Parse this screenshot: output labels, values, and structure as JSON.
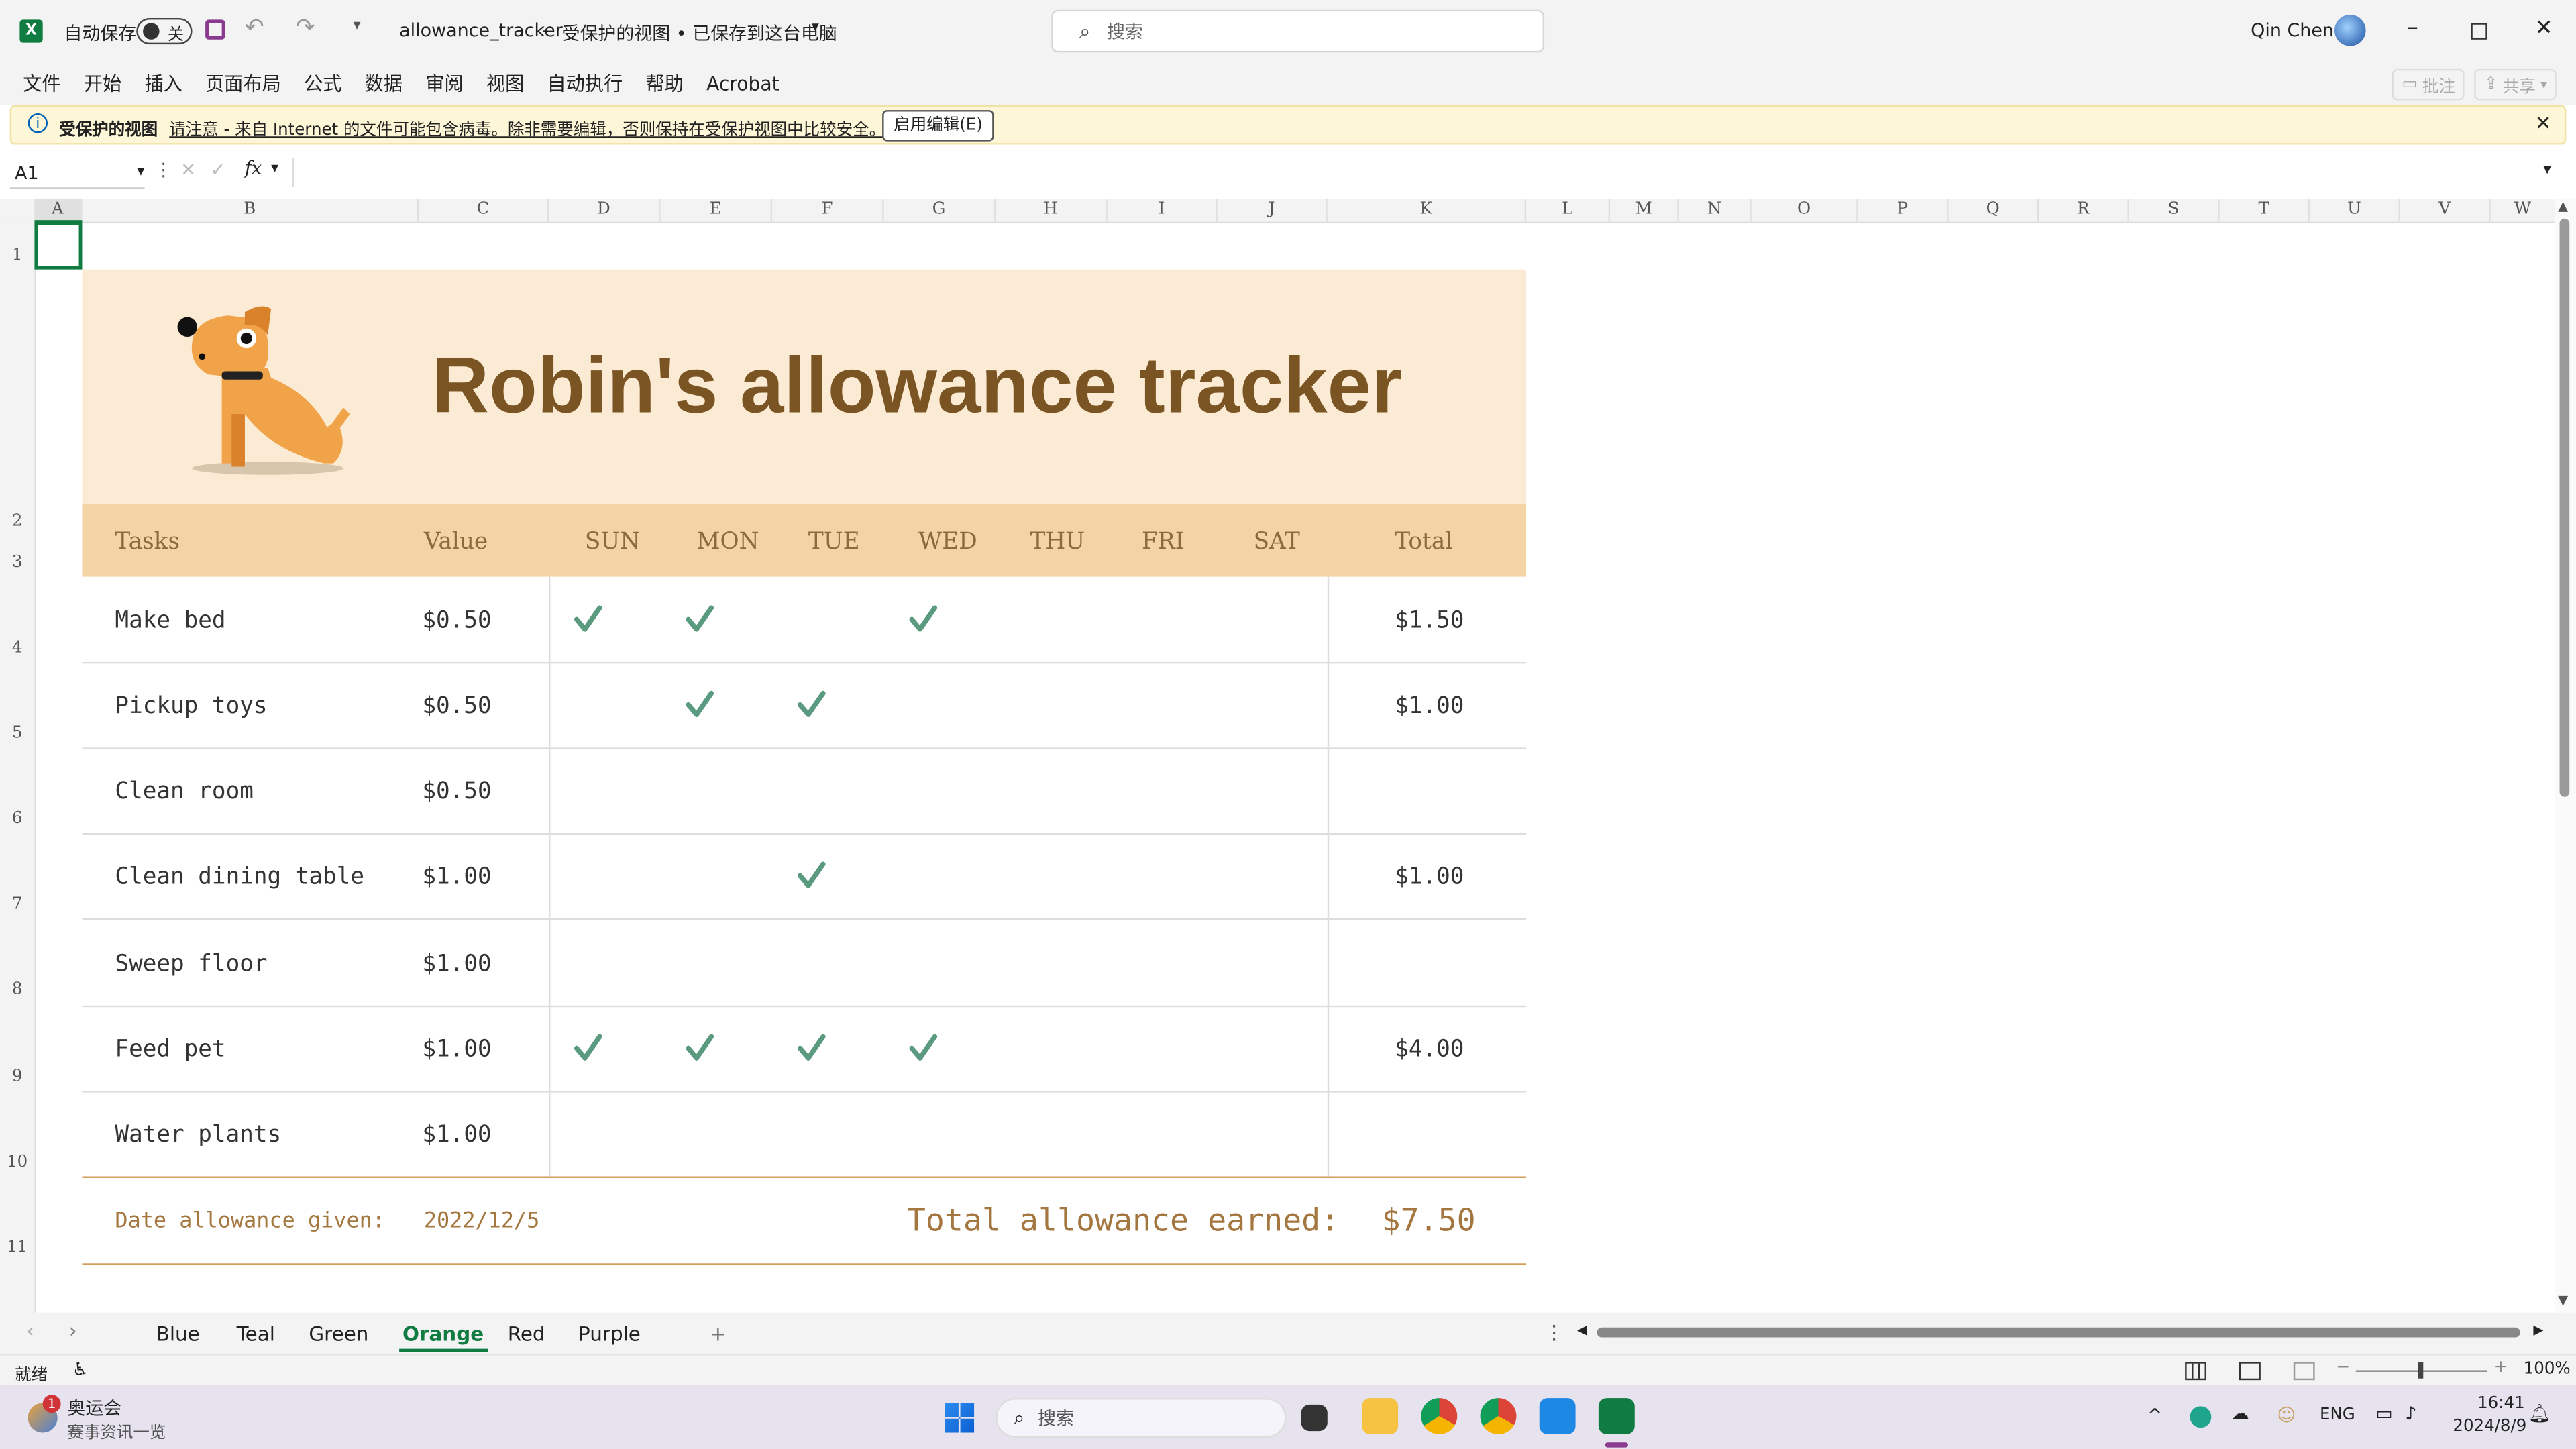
{
  "titlebar": {
    "autosave_label": "自动保存",
    "autosave_state": "关",
    "filename": "allowance_tracker",
    "subtitle": "受保护的视图 • 已保存到这台电脑",
    "search_placeholder": "搜索",
    "user_name": "Qin Chen"
  },
  "menu": {
    "items": [
      "文件",
      "开始",
      "插入",
      "页面布局",
      "公式",
      "数据",
      "审阅",
      "视图",
      "自动执行",
      "帮助",
      "Acrobat"
    ],
    "comment_label": "批注",
    "share_label": "共享"
  },
  "protected": {
    "title": "受保护的视图",
    "message": "请注意 - 来自 Internet 的文件可能包含病毒。除非需要编辑，否则保持在受保护视图中比较安全。",
    "enable_button": "启用编辑(E)"
  },
  "formula_bar": {
    "cell_ref": "A1",
    "fx": "fx",
    "content": ""
  },
  "columns": [
    "A",
    "B",
    "C",
    "D",
    "E",
    "F",
    "G",
    "H",
    "I",
    "J",
    "K",
    "L",
    "M",
    "N",
    "O",
    "P",
    "Q",
    "R",
    "S",
    "T",
    "U",
    "V",
    "W"
  ],
  "rows": [
    "1",
    "2",
    "3",
    "4",
    "5",
    "6",
    "7",
    "8",
    "9",
    "10",
    "11"
  ],
  "tracker": {
    "title": "Robin's allowance tracker",
    "headers": {
      "tasks": "Tasks",
      "value": "Value",
      "days": [
        "SUN",
        "MON",
        "TUE",
        "WED",
        "THU",
        "FRI",
        "SAT"
      ],
      "total": "Total"
    },
    "tasks": [
      {
        "name": "Make bed",
        "value": "$0.50",
        "checks": [
          true,
          true,
          false,
          true,
          false,
          false,
          false
        ],
        "total": "$1.50"
      },
      {
        "name": "Pickup toys",
        "value": "$0.50",
        "checks": [
          false,
          true,
          true,
          false,
          false,
          false,
          false
        ],
        "total": "$1.00"
      },
      {
        "name": "Clean room",
        "value": "$0.50",
        "checks": [
          false,
          false,
          false,
          false,
          false,
          false,
          false
        ],
        "total": ""
      },
      {
        "name": "Clean dining table",
        "value": "$1.00",
        "checks": [
          false,
          false,
          true,
          false,
          false,
          false,
          false
        ],
        "total": "$1.00"
      },
      {
        "name": "Sweep floor",
        "value": "$1.00",
        "checks": [
          false,
          false,
          false,
          false,
          false,
          false,
          false
        ],
        "total": ""
      },
      {
        "name": "Feed pet",
        "value": "$1.00",
        "checks": [
          true,
          true,
          true,
          true,
          false,
          false,
          false
        ],
        "total": "$4.00"
      },
      {
        "name": "Water plants",
        "value": "$1.00",
        "checks": [
          false,
          false,
          false,
          false,
          false,
          false,
          false
        ],
        "total": ""
      }
    ],
    "date_label": "Date allowance given:",
    "date_value": "2022/12/5",
    "total_label": "Total allowance earned:",
    "total_value": "$7.50"
  },
  "sheets": {
    "tabs": [
      "Blue",
      "Teal",
      "Green",
      "Orange",
      "Red",
      "Purple"
    ],
    "active": "Orange",
    "add_label": "+"
  },
  "status": {
    "ready": "就绪",
    "zoom": "100%"
  },
  "taskbar": {
    "widget_title": "奥运会",
    "widget_sub": "赛事资讯一览",
    "widget_badge": "1",
    "search_placeholder": "搜索",
    "lang": "ENG",
    "time": "16:41",
    "date": "2024/8/9"
  },
  "colors": {
    "banner": "#fcebd4",
    "header": "#f3d4a5",
    "title_text": "#7a5523",
    "check": "#5a9a7f"
  }
}
